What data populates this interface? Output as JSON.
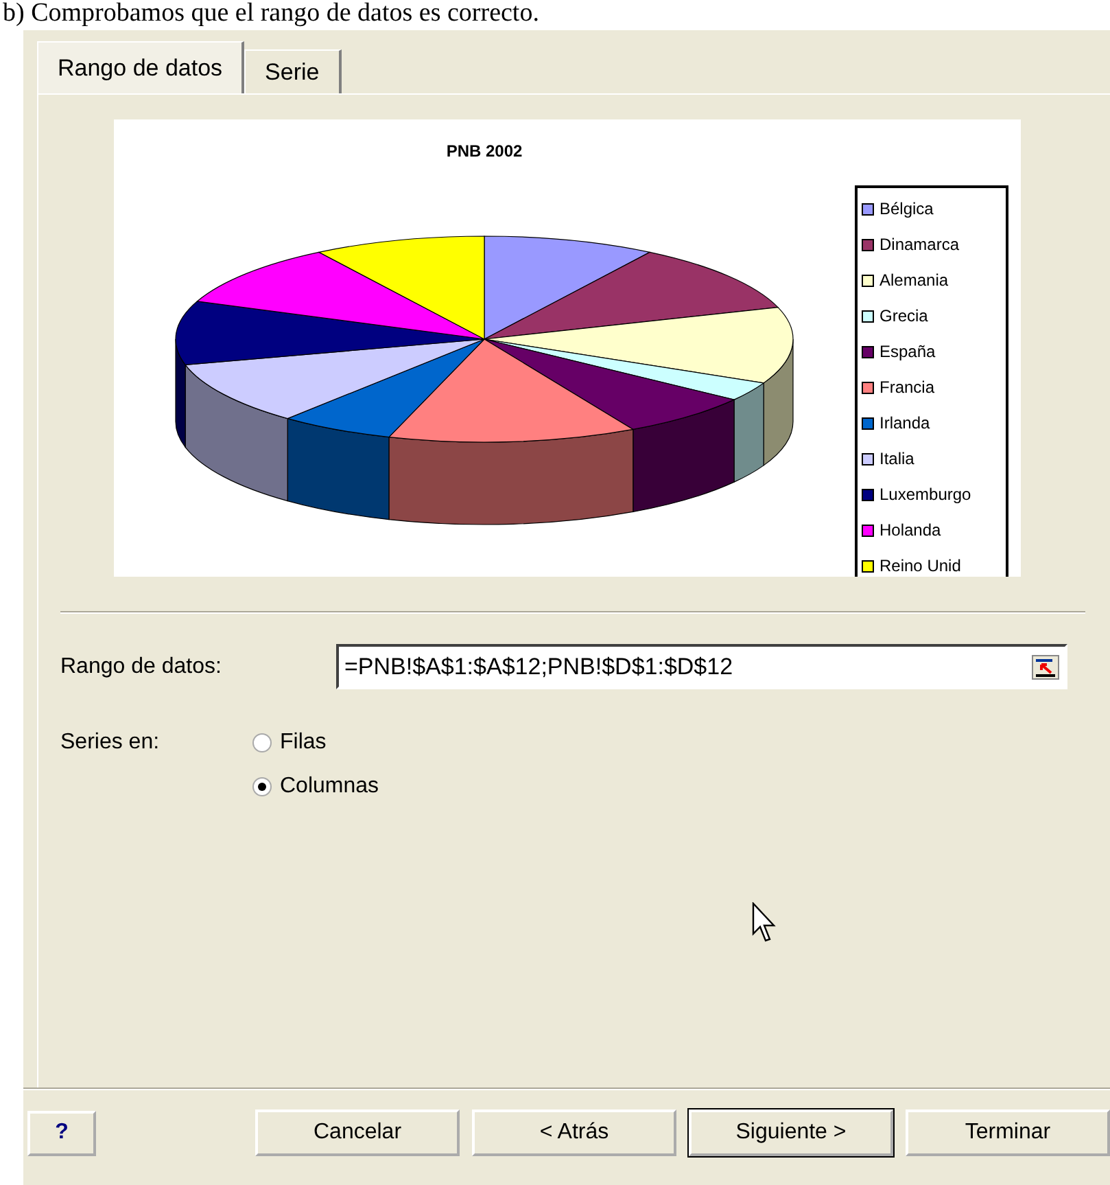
{
  "heading": "b)   Comprobamos que el rango de datos es correcto.",
  "tabs": [
    {
      "label": "Rango de datos",
      "selected": true
    },
    {
      "label": "Serie",
      "selected": false
    }
  ],
  "chart": {
    "title": "PNB 2002",
    "legend": [
      {
        "label": "Bélgica",
        "color": "#9999ff"
      },
      {
        "label": "Dinamarca",
        "color": "#993366"
      },
      {
        "label": "Alemania",
        "color": "#ffffcc"
      },
      {
        "label": "Grecia",
        "color": "#ccffff"
      },
      {
        "label": "España",
        "color": "#660066"
      },
      {
        "label": "Francia",
        "color": "#ff8080"
      },
      {
        "label": "Irlanda",
        "color": "#0066cc"
      },
      {
        "label": "Italia",
        "color": "#ccccff"
      },
      {
        "label": "Luxemburgo",
        "color": "#000080"
      },
      {
        "label": "Holanda",
        "color": "#ff00ff"
      },
      {
        "label": "Reino Unid",
        "color": "#ffff00"
      }
    ]
  },
  "data_range": {
    "label": "Rango de datos:",
    "value": "=PNB!$A$1:$A$12;PNB!$D$1:$D$12"
  },
  "series_in": {
    "label": "Series en:",
    "options": [
      {
        "label": "Filas",
        "selected": false
      },
      {
        "label": "Columnas",
        "selected": true
      }
    ]
  },
  "help_button": "?",
  "buttons": [
    {
      "label": "Cancelar",
      "default": false
    },
    {
      "label": "< Atrás",
      "default": false
    },
    {
      "label": "Siguiente >",
      "default": true
    },
    {
      "label": "Terminar",
      "default": false
    }
  ]
}
